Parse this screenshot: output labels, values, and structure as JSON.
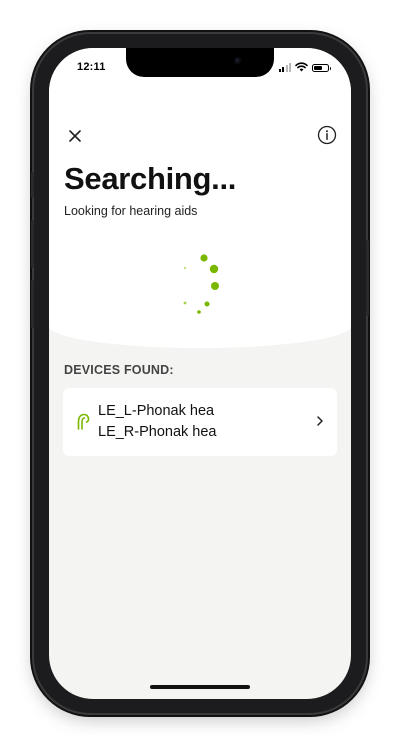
{
  "status_bar": {
    "time": "12:11"
  },
  "header": {
    "close_icon": "close-icon",
    "info_icon": "info-icon"
  },
  "main": {
    "title": "Searching...",
    "subtitle": "Looking for hearing aids",
    "spinner_icon": "loading-spinner-icon"
  },
  "devices": {
    "section_label": "DEVICES FOUND:",
    "items": [
      {
        "left_name": "LE_L-Phonak hea",
        "right_name": "LE_R-Phonak hea",
        "icon": "hearing-aid-icon",
        "chevron_icon": "chevron-right-icon"
      }
    ]
  },
  "colors": {
    "accent": "#7ab800",
    "background": "#f4f4f3",
    "card": "#ffffff"
  }
}
